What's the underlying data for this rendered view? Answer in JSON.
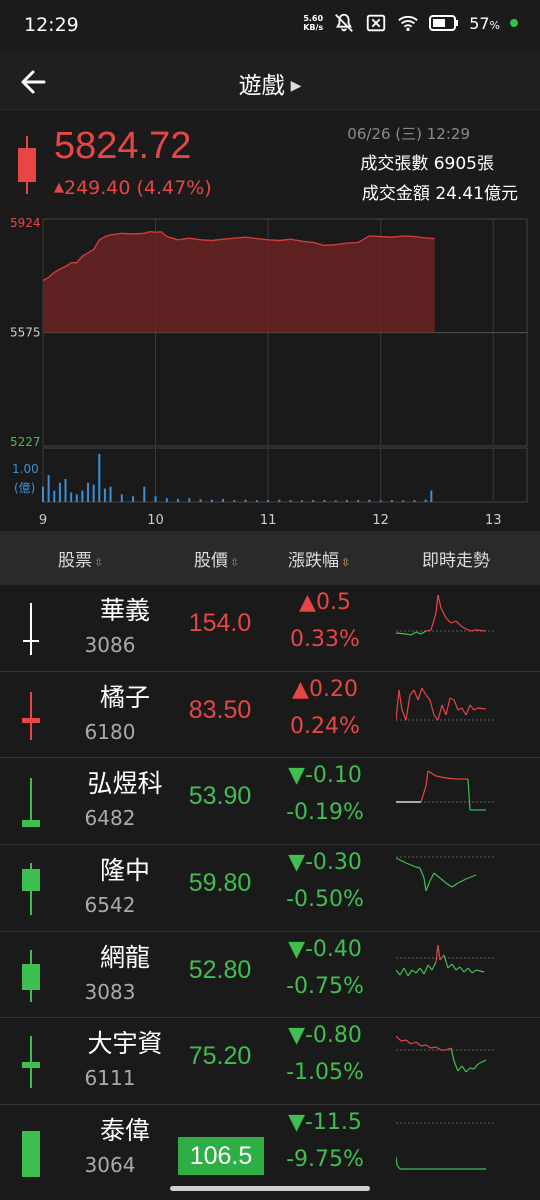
{
  "status_bar": {
    "time": "12:29",
    "speed_value": "5.60",
    "speed_unit": "KB/s",
    "battery_pct": "57",
    "battery_unit": "%",
    "icons": [
      "mute-icon",
      "close-box-icon",
      "wifi-icon",
      "battery-icon"
    ]
  },
  "header": {
    "title": "遊戲",
    "title_arrow": "▶"
  },
  "summary": {
    "index_value": "5824.72",
    "change": "249.40 (4.47%)",
    "change_arrow": "▲",
    "date_time": "06/26 (三) 12:29",
    "volume": "成交張數 6905張",
    "amount": "成交金額 24.41億元",
    "color_up": "#e84545"
  },
  "chart_data": {
    "type": "area",
    "y_ticks": [
      "5924",
      "5575",
      "5227"
    ],
    "volume_ticks": [
      "1.00",
      "(億)"
    ],
    "x_ticks": [
      "9",
      "10",
      "11",
      "12",
      "13"
    ],
    "ylim": [
      5227,
      5924
    ],
    "reference": 5575,
    "x_range": [
      9,
      13.3
    ],
    "price_series": [
      [
        9.0,
        5735
      ],
      [
        9.05,
        5745
      ],
      [
        9.1,
        5760
      ],
      [
        9.15,
        5770
      ],
      [
        9.2,
        5778
      ],
      [
        9.25,
        5790
      ],
      [
        9.3,
        5790
      ],
      [
        9.35,
        5810
      ],
      [
        9.4,
        5820
      ],
      [
        9.45,
        5830
      ],
      [
        9.5,
        5860
      ],
      [
        9.55,
        5870
      ],
      [
        9.6,
        5875
      ],
      [
        9.7,
        5880
      ],
      [
        9.8,
        5878
      ],
      [
        9.9,
        5880
      ],
      [
        9.95,
        5885
      ],
      [
        10.0,
        5883
      ],
      [
        10.05,
        5885
      ],
      [
        10.1,
        5870
      ],
      [
        10.2,
        5860
      ],
      [
        10.3,
        5865
      ],
      [
        10.4,
        5860
      ],
      [
        10.5,
        5858
      ],
      [
        10.6,
        5862
      ],
      [
        10.7,
        5865
      ],
      [
        10.8,
        5868
      ],
      [
        10.9,
        5864
      ],
      [
        11.0,
        5860
      ],
      [
        11.1,
        5858
      ],
      [
        11.2,
        5862
      ],
      [
        11.3,
        5856
      ],
      [
        11.4,
        5852
      ],
      [
        11.5,
        5843
      ],
      [
        11.6,
        5845
      ],
      [
        11.7,
        5850
      ],
      [
        11.8,
        5852
      ],
      [
        11.85,
        5862
      ],
      [
        11.9,
        5872
      ],
      [
        12.0,
        5870
      ],
      [
        12.1,
        5868
      ],
      [
        12.2,
        5872
      ],
      [
        12.3,
        5870
      ],
      [
        12.4,
        5866
      ],
      [
        12.48,
        5864
      ]
    ],
    "volume_series": [
      [
        9.0,
        0.4
      ],
      [
        9.05,
        0.7
      ],
      [
        9.1,
        0.3
      ],
      [
        9.15,
        0.5
      ],
      [
        9.2,
        0.6
      ],
      [
        9.25,
        0.25
      ],
      [
        9.3,
        0.2
      ],
      [
        9.35,
        0.3
      ],
      [
        9.4,
        0.5
      ],
      [
        9.45,
        0.45
      ],
      [
        9.5,
        1.25
      ],
      [
        9.55,
        0.35
      ],
      [
        9.6,
        0.4
      ],
      [
        9.7,
        0.2
      ],
      [
        9.8,
        0.15
      ],
      [
        9.9,
        0.4
      ],
      [
        10.0,
        0.15
      ],
      [
        10.1,
        0.1
      ],
      [
        10.2,
        0.08
      ],
      [
        10.3,
        0.1
      ],
      [
        10.4,
        0.07
      ],
      [
        10.5,
        0.06
      ],
      [
        10.6,
        0.08
      ],
      [
        10.7,
        0.05
      ],
      [
        10.8,
        0.06
      ],
      [
        10.9,
        0.05
      ],
      [
        11.0,
        0.05
      ],
      [
        11.1,
        0.06
      ],
      [
        11.2,
        0.05
      ],
      [
        11.3,
        0.04
      ],
      [
        11.4,
        0.05
      ],
      [
        11.5,
        0.05
      ],
      [
        11.6,
        0.04
      ],
      [
        11.7,
        0.05
      ],
      [
        11.8,
        0.05
      ],
      [
        11.9,
        0.06
      ],
      [
        12.0,
        0.04
      ],
      [
        12.1,
        0.05
      ],
      [
        12.2,
        0.04
      ],
      [
        12.3,
        0.05
      ],
      [
        12.4,
        0.06
      ],
      [
        12.45,
        0.3
      ]
    ],
    "color_line": "#d33a3a",
    "color_fill": "#6b2323",
    "color_volume": "#3a8fd8",
    "grid": true
  },
  "list_header": {
    "col_stock": "股票",
    "col_price": "股價",
    "col_change": "漲跌幅",
    "col_trend": "即時走勢",
    "sort_icon": "⇳",
    "sort_icon_active": "⇳"
  },
  "stocks": [
    {
      "name": "華義",
      "code": "3086",
      "price": "154.0",
      "change": "▲0.5",
      "pct": "0.33%",
      "dir": "up",
      "candle": {
        "type": "doji-white"
      },
      "spark": [
        [
          0,
          40
        ],
        [
          10,
          41
        ],
        [
          15,
          42
        ],
        [
          20,
          39
        ],
        [
          25,
          41
        ],
        [
          30,
          38
        ],
        [
          35,
          37
        ],
        [
          40,
          20
        ],
        [
          42,
          2
        ],
        [
          45,
          15
        ],
        [
          50,
          25
        ],
        [
          55,
          30
        ],
        [
          60,
          28
        ],
        [
          65,
          33
        ],
        [
          70,
          36
        ],
        [
          75,
          38
        ],
        [
          80,
          37
        ],
        [
          90,
          38
        ]
      ],
      "ref": 38,
      "highlight": false
    },
    {
      "name": "橘子",
      "code": "6180",
      "price": "83.50",
      "change": "▲0.20",
      "pct": "0.24%",
      "dir": "up",
      "candle": {
        "type": "red-small"
      },
      "spark": [
        [
          0,
          40
        ],
        [
          3,
          10
        ],
        [
          6,
          30
        ],
        [
          10,
          40
        ],
        [
          14,
          15
        ],
        [
          18,
          10
        ],
        [
          22,
          20
        ],
        [
          26,
          8
        ],
        [
          30,
          15
        ],
        [
          34,
          20
        ],
        [
          38,
          35
        ],
        [
          42,
          40
        ],
        [
          46,
          25
        ],
        [
          50,
          35
        ],
        [
          54,
          18
        ],
        [
          58,
          20
        ],
        [
          62,
          30
        ],
        [
          66,
          28
        ],
        [
          70,
          35
        ],
        [
          74,
          25
        ],
        [
          78,
          30
        ],
        [
          82,
          28
        ],
        [
          90,
          29
        ]
      ],
      "ref": 40,
      "highlight": false
    },
    {
      "name": "弘煜科",
      "code": "6482",
      "price": "53.90",
      "change": "▼-0.10",
      "pct": "-0.19%",
      "dir": "down",
      "candle": {
        "type": "green-small"
      },
      "spark": [
        [
          0,
          36
        ],
        [
          25,
          36
        ],
        [
          30,
          20
        ],
        [
          32,
          5
        ],
        [
          40,
          10
        ],
        [
          50,
          12
        ],
        [
          60,
          13
        ],
        [
          72,
          13
        ],
        [
          74,
          44
        ],
        [
          90,
          44
        ]
      ],
      "ref": 36,
      "highlight": false,
      "spark_colors": [
        "#fff",
        "#e84545",
        "#e84545",
        "#3fbf50"
      ]
    },
    {
      "name": "隆中",
      "code": "6542",
      "price": "59.80",
      "change": "▼-0.30",
      "pct": "-0.50%",
      "dir": "down",
      "candle": {
        "type": "green-body"
      },
      "spark": [
        [
          0,
          5
        ],
        [
          10,
          10
        ],
        [
          20,
          14
        ],
        [
          24,
          15
        ],
        [
          28,
          25
        ],
        [
          30,
          38
        ],
        [
          34,
          28
        ],
        [
          38,
          20
        ],
        [
          44,
          25
        ],
        [
          50,
          30
        ],
        [
          56,
          34
        ],
        [
          62,
          30
        ],
        [
          70,
          26
        ],
        [
          80,
          22
        ]
      ],
      "ref": 4,
      "highlight": false
    },
    {
      "name": "網龍",
      "code": "3083",
      "price": "52.80",
      "change": "▼-0.40",
      "pct": "-0.75%",
      "dir": "down",
      "candle": {
        "type": "green-body2"
      },
      "spark": [
        [
          0,
          30
        ],
        [
          4,
          35
        ],
        [
          8,
          28
        ],
        [
          12,
          36
        ],
        [
          16,
          30
        ],
        [
          20,
          33
        ],
        [
          24,
          28
        ],
        [
          28,
          34
        ],
        [
          32,
          25
        ],
        [
          36,
          30
        ],
        [
          40,
          22
        ],
        [
          42,
          5
        ],
        [
          44,
          20
        ],
        [
          48,
          15
        ],
        [
          52,
          28
        ],
        [
          56,
          24
        ],
        [
          60,
          30
        ],
        [
          64,
          27
        ],
        [
          68,
          32
        ],
        [
          72,
          28
        ],
        [
          76,
          33
        ],
        [
          80,
          30
        ],
        [
          88,
          32
        ]
      ],
      "ref": 18,
      "highlight": false
    },
    {
      "name": "大宇資",
      "code": "6111",
      "price": "75.20",
      "change": "▼-0.80",
      "pct": "-1.05%",
      "dir": "down",
      "candle": {
        "type": "green-cross"
      },
      "spark": [
        [
          0,
          10
        ],
        [
          5,
          15
        ],
        [
          10,
          14
        ],
        [
          15,
          18
        ],
        [
          20,
          16
        ],
        [
          25,
          20
        ],
        [
          30,
          19
        ],
        [
          35,
          22
        ],
        [
          40,
          21
        ],
        [
          45,
          24
        ],
        [
          50,
          24
        ],
        [
          55,
          22
        ],
        [
          58,
          35
        ],
        [
          62,
          45
        ],
        [
          66,
          40
        ],
        [
          70,
          46
        ],
        [
          74,
          42
        ],
        [
          78,
          43
        ],
        [
          82,
          38
        ],
        [
          90,
          34
        ]
      ],
      "ref": 24,
      "highlight": false
    },
    {
      "name": "泰偉",
      "code": "3064",
      "price": "106.5",
      "change": "▼-11.5",
      "pct": "-9.75%",
      "dir": "down",
      "candle": {
        "type": "green-tall"
      },
      "spark": [
        [
          0,
          44
        ],
        [
          1,
          52
        ],
        [
          4,
          56
        ],
        [
          30,
          56
        ],
        [
          60,
          56
        ],
        [
          90,
          56
        ]
      ],
      "ref": 10,
      "highlight": true
    }
  ],
  "colors": {
    "up": "#e84545",
    "down": "#3fbf50",
    "flat": "#ffffff"
  }
}
